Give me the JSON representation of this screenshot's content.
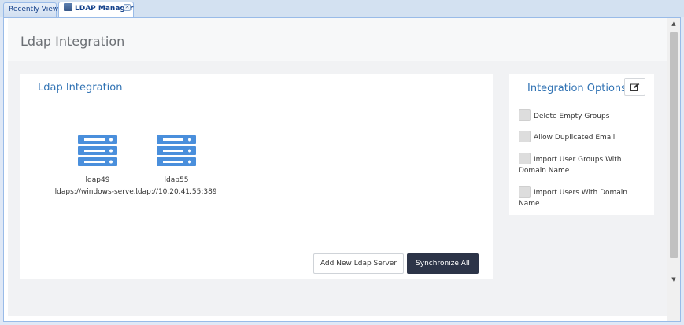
{
  "tabs": [
    {
      "label": "Recently View",
      "active": false
    },
    {
      "label": "LDAP Manager",
      "active": true
    }
  ],
  "page": {
    "title": "Ldap Integration"
  },
  "main_panel": {
    "title": "Ldap Integration",
    "servers": [
      {
        "name": "ldap49",
        "url": "ldaps://windows-serve..."
      },
      {
        "name": "ldap55",
        "url": "ldap://10.20.41.55:389"
      }
    ],
    "add_button_label": "Add New Ldap Server",
    "sync_button_label": "Synchronize All"
  },
  "options_panel": {
    "title": "Integration Options",
    "edit_icon": "edit-icon",
    "options": [
      {
        "label": "Delete Empty Groups",
        "checked": false
      },
      {
        "label": "Allow Duplicated Email",
        "checked": false
      },
      {
        "label": "Import User Groups With Domain Name",
        "checked": false
      },
      {
        "label": "Import Users With Domain Name",
        "checked": false
      }
    ]
  },
  "colors": {
    "accent": "#3173b4",
    "server_icon": "#4a8fdc",
    "primary_button": "#2c3448"
  }
}
